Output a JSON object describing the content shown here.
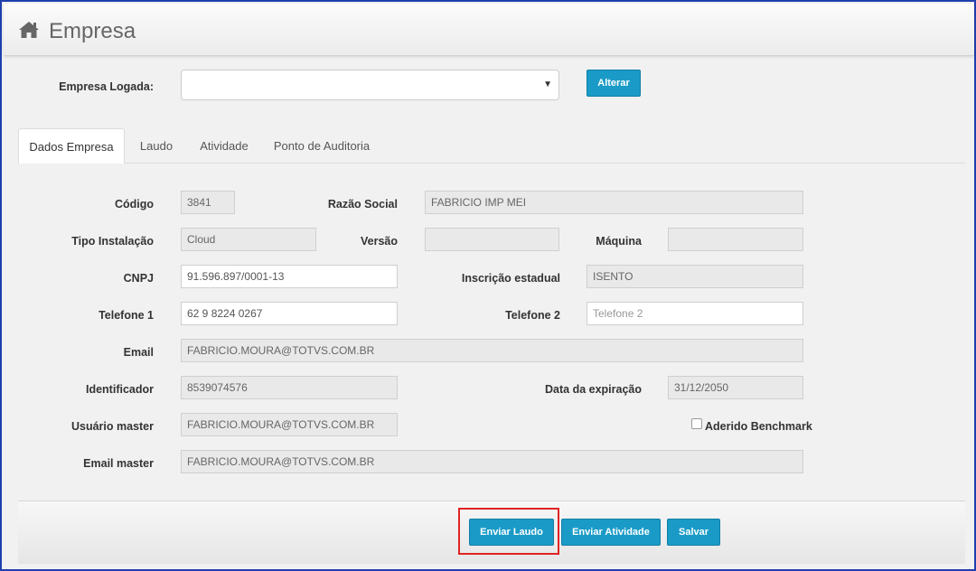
{
  "header": {
    "title": "Empresa",
    "icon": "home-icon"
  },
  "empresa_logada": {
    "label": "Empresa Logada:",
    "value": "",
    "button": "Alterar"
  },
  "tabs": [
    {
      "label": "Dados Empresa",
      "active": true
    },
    {
      "label": "Laudo",
      "active": false
    },
    {
      "label": "Atividade",
      "active": false
    },
    {
      "label": "Ponto de Auditoria",
      "active": false
    }
  ],
  "form": {
    "codigo": {
      "label": "Código",
      "value": "3841"
    },
    "razao_social": {
      "label": "Razão Social",
      "value": "FABRICIO IMP MEI"
    },
    "tipo_instalacao": {
      "label": "Tipo Instalação",
      "value": "Cloud"
    },
    "versao": {
      "label": "Versão",
      "value": ""
    },
    "maquina": {
      "label": "Máquina",
      "value": ""
    },
    "cnpj": {
      "label": "CNPJ",
      "value": "91.596.897/0001-13"
    },
    "inscricao_estadual": {
      "label": "Inscrição estadual",
      "value": "ISENTO"
    },
    "telefone1": {
      "label": "Telefone 1",
      "value": "62 9 8224 0267"
    },
    "telefone2": {
      "label": "Telefone 2",
      "value": "",
      "placeholder": "Telefone 2"
    },
    "email": {
      "label": "Email",
      "value": "FABRICIO.MOURA@TOTVS.COM.BR"
    },
    "identificador": {
      "label": "Identificador",
      "value": "8539074576"
    },
    "data_expiracao": {
      "label": "Data da expiração",
      "value": "31/12/2050"
    },
    "usuario_master": {
      "label": "Usuário master",
      "value": "FABRICIO.MOURA@TOTVS.COM.BR"
    },
    "aderido_benchmark": {
      "label": "Aderido Benchmark",
      "checked": false
    },
    "email_master": {
      "label": "Email master",
      "value": "FABRICIO.MOURA@TOTVS.COM.BR"
    }
  },
  "footer": {
    "enviar_laudo": "Enviar Laudo",
    "enviar_atividade": "Enviar Atividade",
    "salvar": "Salvar"
  },
  "colors": {
    "primary_button": "#1a9bc7",
    "highlight_border": "#e02424",
    "window_border": "#1f3fae"
  }
}
